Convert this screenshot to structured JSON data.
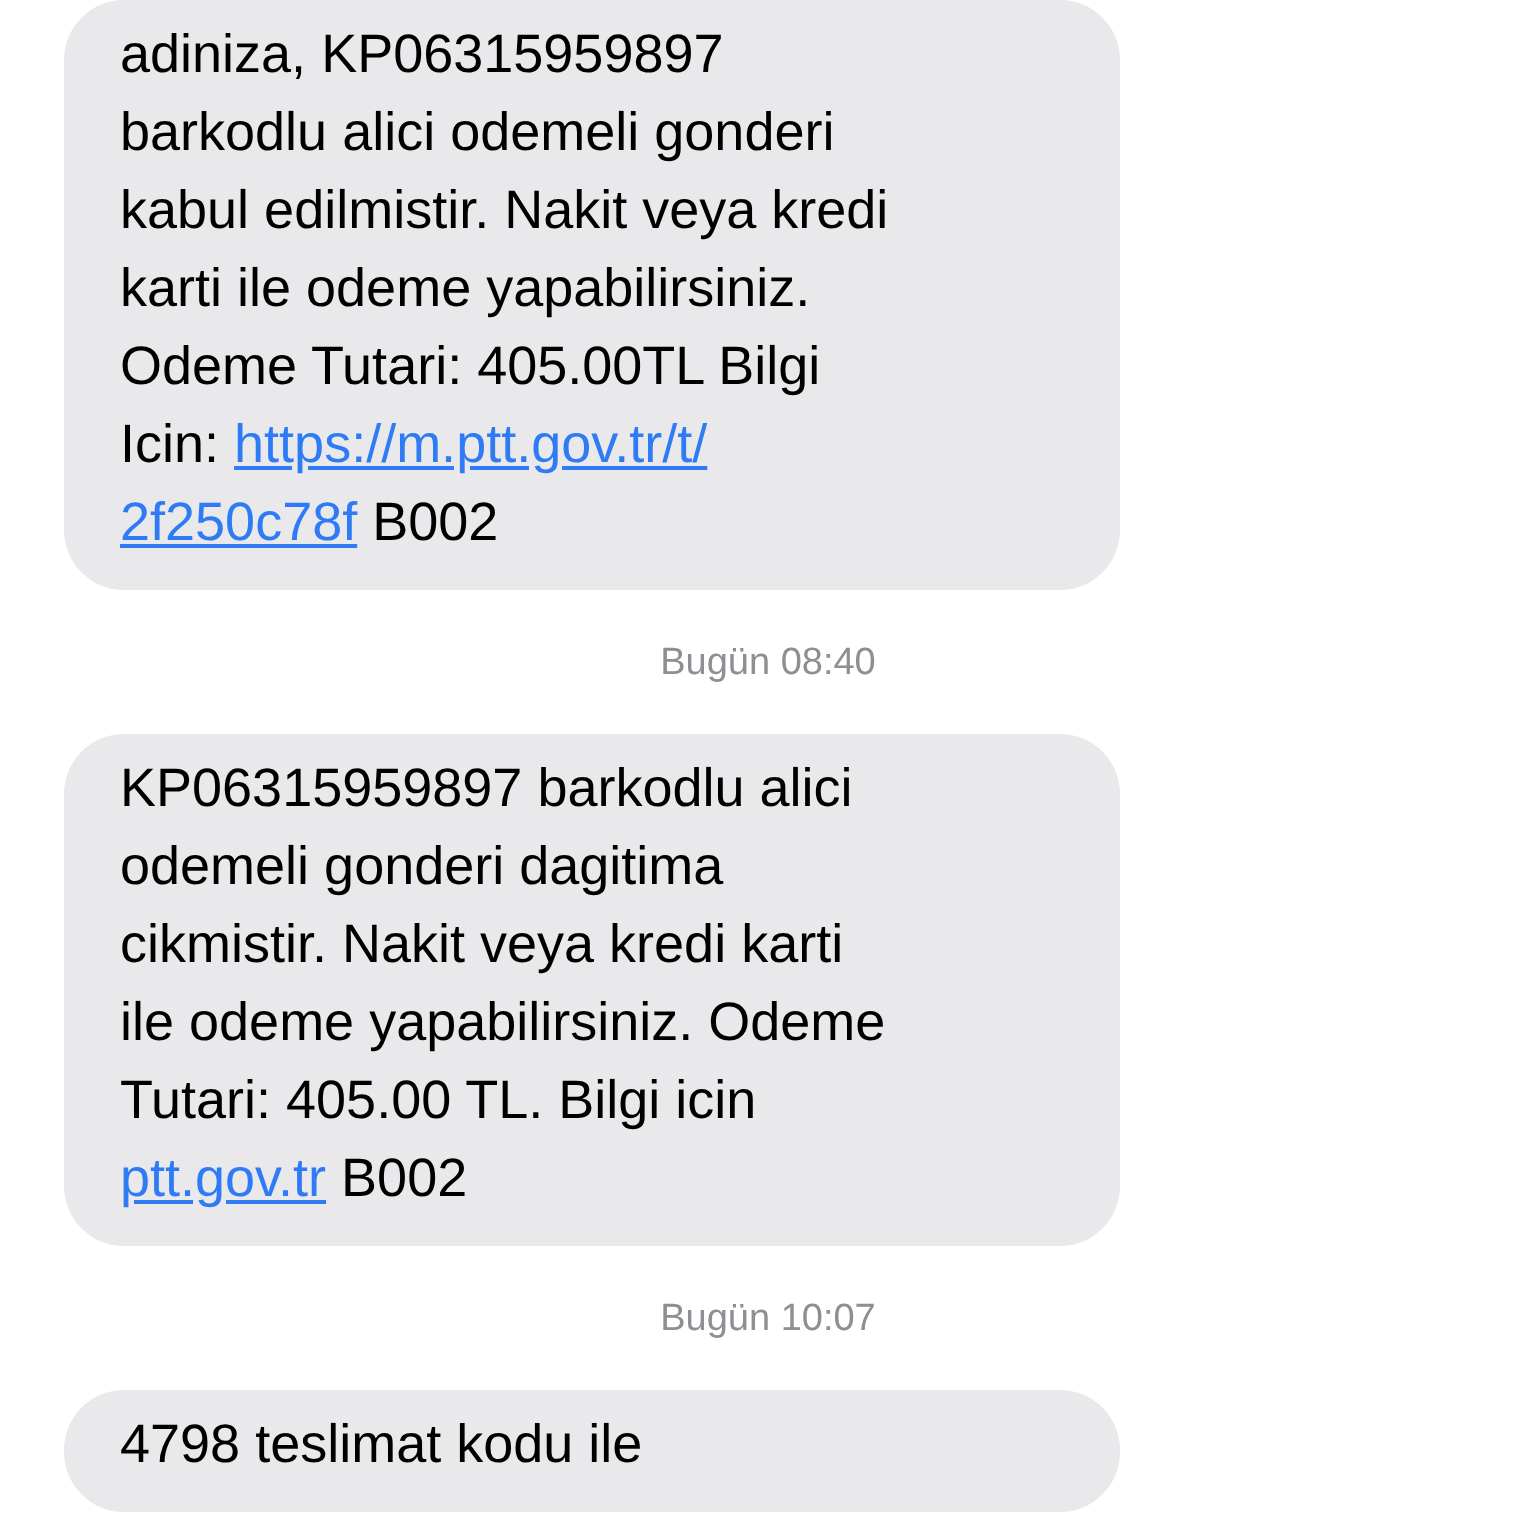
{
  "messages": [
    {
      "kind": "message",
      "lines": [
        [
          {
            "kind": "text",
            "text": "adiniza, KP06315959897"
          }
        ],
        [
          {
            "kind": "text",
            "text": "barkodlu alici odemeli gonderi"
          }
        ],
        [
          {
            "kind": "text",
            "text": "kabul edilmistir. Nakit veya kredi"
          }
        ],
        [
          {
            "kind": "text",
            "text": "karti ile odeme yapabilirsiniz."
          }
        ],
        [
          {
            "kind": "text",
            "text": "Odeme Tutari: 405.00TL Bilgi"
          }
        ],
        [
          {
            "kind": "text",
            "text": "Icin: "
          },
          {
            "kind": "link",
            "text": "https://m.ptt.gov.tr/t/"
          }
        ],
        [
          {
            "kind": "link",
            "text": "2f250c78f"
          },
          {
            "kind": "text",
            "text": " B002"
          }
        ]
      ]
    },
    {
      "kind": "timestamp",
      "text": "Bugün 08:40"
    },
    {
      "kind": "message",
      "lines": [
        [
          {
            "kind": "text",
            "text": "KP06315959897 barkodlu alici"
          }
        ],
        [
          {
            "kind": "text",
            "text": "odemeli gonderi dagitima"
          }
        ],
        [
          {
            "kind": "text",
            "text": "cikmistir. Nakit veya kredi karti"
          }
        ],
        [
          {
            "kind": "text",
            "text": "ile odeme yapabilirsiniz. Odeme"
          }
        ],
        [
          {
            "kind": "text",
            "text": "Tutari: 405.00 TL. Bilgi icin"
          }
        ],
        [
          {
            "kind": "link",
            "text": "ptt.gov.tr"
          },
          {
            "kind": "text",
            "text": " B002"
          }
        ]
      ]
    },
    {
      "kind": "timestamp",
      "text": "Bugün 10:07"
    },
    {
      "kind": "message",
      "lines": [
        [
          {
            "kind": "text",
            "text": "4798 teslimat kodu ile"
          }
        ]
      ]
    }
  ]
}
